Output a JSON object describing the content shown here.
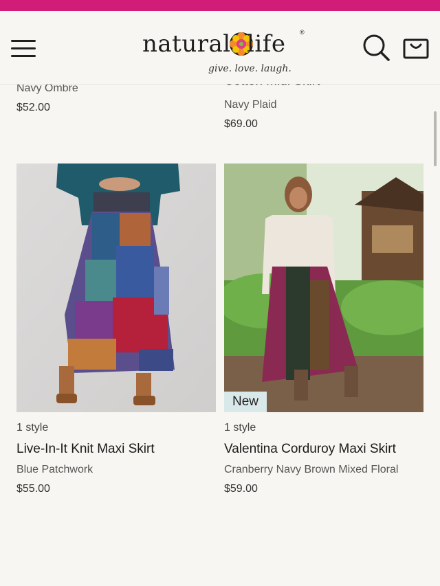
{
  "header": {
    "logo_left": "natural",
    "logo_right": "life",
    "logo_reg": "®",
    "logo_tagline": "give. love. laugh.",
    "promo_color": "#d21d78"
  },
  "top_row": {
    "left": {
      "color": "Navy Ombre",
      "price": "$52.00"
    },
    "right": {
      "name": "Cotton Midi Skirt",
      "color": "Navy Plaid",
      "price": "$69.00"
    }
  },
  "products": [
    {
      "style_count": "1 style",
      "name": "Live-In-It Knit Maxi Skirt",
      "color": "Blue Patchwork",
      "price": "$55.00",
      "badge": ""
    },
    {
      "style_count": "1 style",
      "name": "Valentina Corduroy Maxi Skirt",
      "color": "Cranberry Navy Brown Mixed Floral",
      "price": "$59.00",
      "badge": "New"
    }
  ],
  "icons": {
    "menu": "hamburger-menu-icon",
    "search": "search-icon",
    "bag": "shopping-bag-icon"
  }
}
